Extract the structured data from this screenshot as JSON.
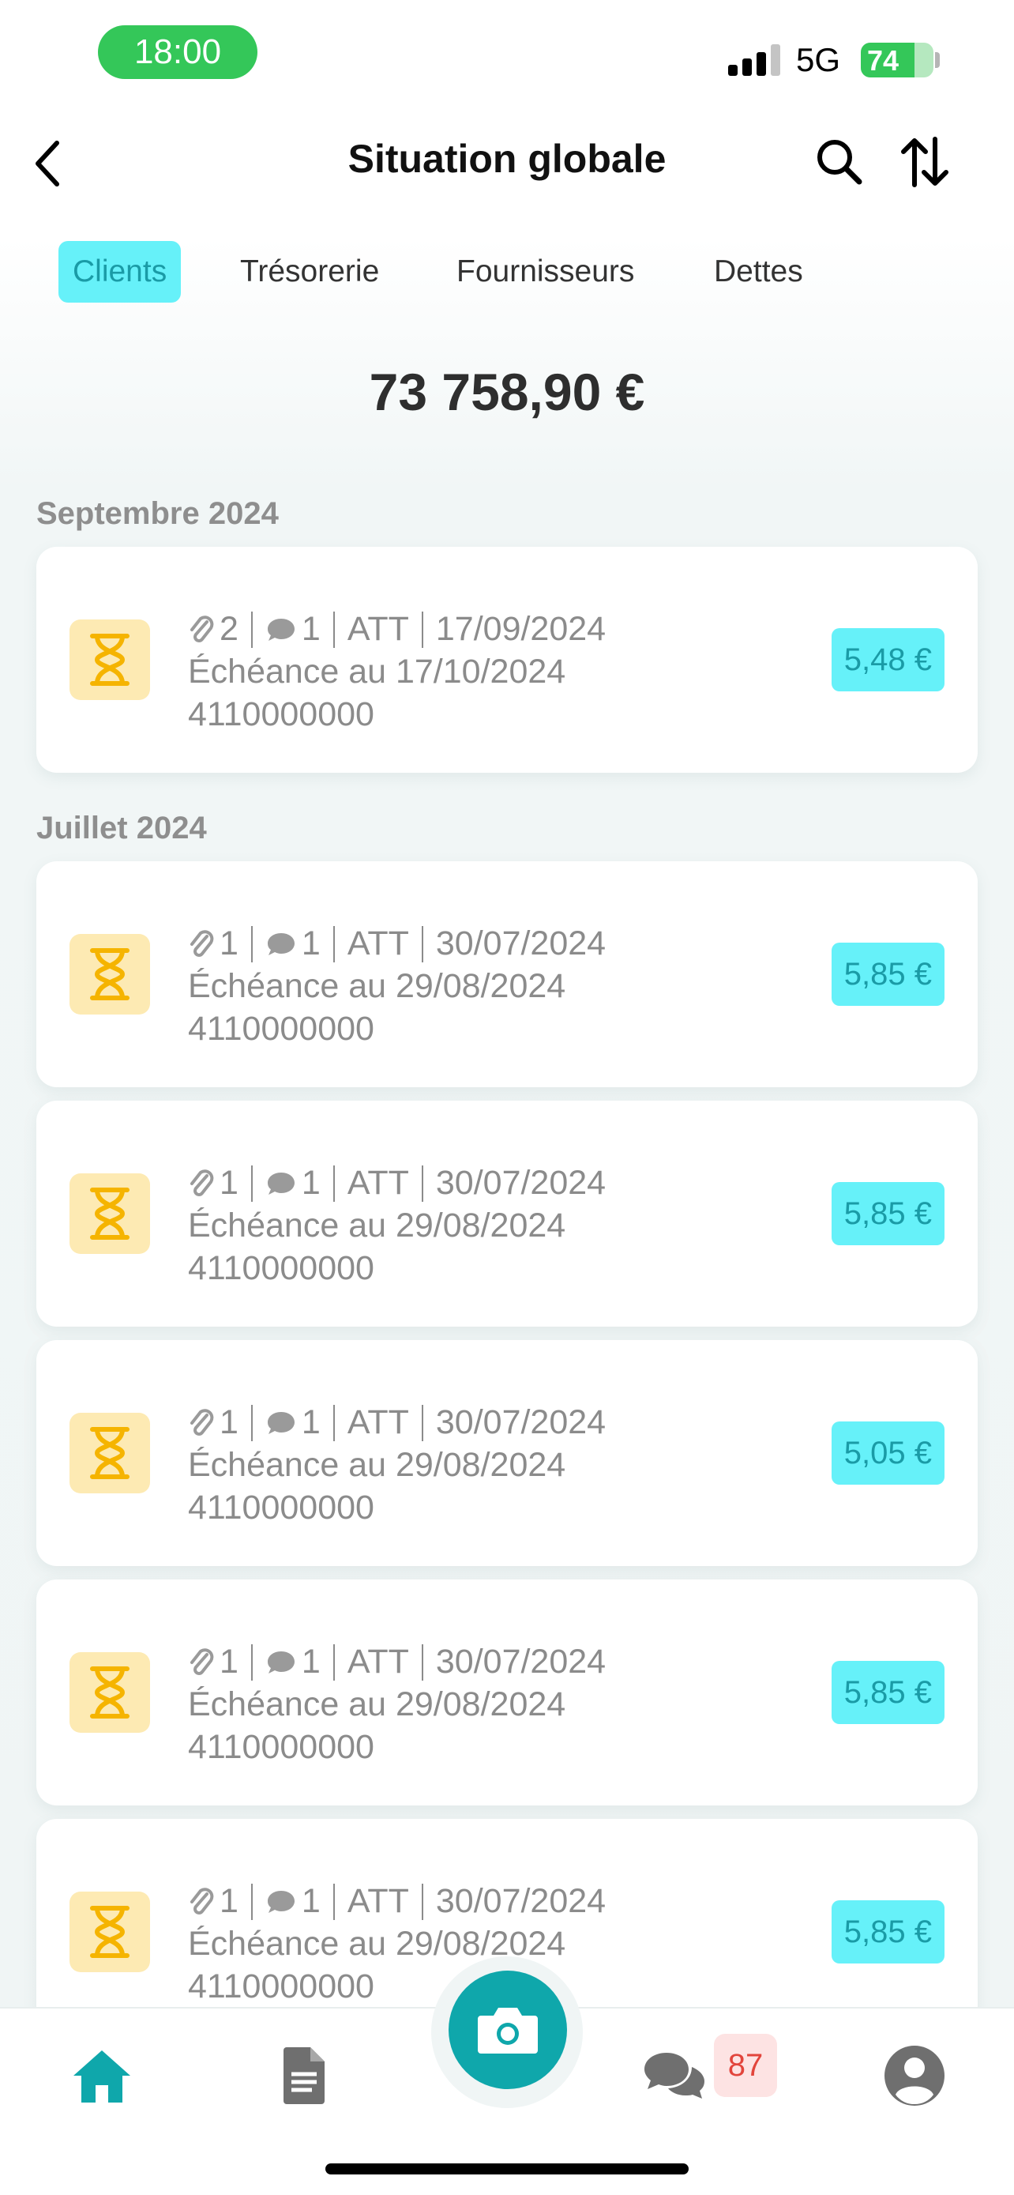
{
  "status_bar": {
    "time": "18:00",
    "network": "5G",
    "battery_level": "74",
    "battery_fraction": 0.74
  },
  "header": {
    "title": "Situation globale",
    "icons": {
      "back": "chevron-left-icon",
      "search": "search-icon",
      "sort": "sort-icon"
    }
  },
  "tabs": [
    {
      "label": "Clients",
      "active": true
    },
    {
      "label": "Trésorerie",
      "active": false
    },
    {
      "label": "Fournisseurs",
      "active": false
    },
    {
      "label": "Dettes",
      "active": false
    }
  ],
  "total": "73 758,90 €",
  "sections": [
    {
      "label": "Septembre 2024",
      "items": [
        {
          "attachments": "2",
          "comments": "1",
          "status": "ATT",
          "date": "17/09/2024",
          "due": "Échéance au 17/10/2024",
          "account": "4110000000",
          "amount": "5,48 €"
        }
      ]
    },
    {
      "label": "Juillet 2024",
      "items": [
        {
          "attachments": "1",
          "comments": "1",
          "status": "ATT",
          "date": "30/07/2024",
          "due": "Échéance au 29/08/2024",
          "account": "4110000000",
          "amount": "5,85 €"
        },
        {
          "attachments": "1",
          "comments": "1",
          "status": "ATT",
          "date": "30/07/2024",
          "due": "Échéance au 29/08/2024",
          "account": "4110000000",
          "amount": "5,85 €"
        },
        {
          "attachments": "1",
          "comments": "1",
          "status": "ATT",
          "date": "30/07/2024",
          "due": "Échéance au 29/08/2024",
          "account": "4110000000",
          "amount": "5,05 €"
        },
        {
          "attachments": "1",
          "comments": "1",
          "status": "ATT",
          "date": "30/07/2024",
          "due": "Échéance au 29/08/2024",
          "account": "4110000000",
          "amount": "5,85 €"
        },
        {
          "attachments": "1",
          "comments": "1",
          "status": "ATT",
          "date": "30/07/2024",
          "due": "Échéance au 29/08/2024",
          "account": "4110000000",
          "amount": "5,85 €"
        }
      ]
    }
  ],
  "bottom_nav": {
    "messages_badge": "87",
    "icons": [
      "home-icon",
      "document-icon",
      "camera-icon",
      "chat-icon",
      "profile-icon"
    ]
  },
  "colors": {
    "accent": "#66f1f9",
    "accent_text": "#1a9ba6",
    "pending": "#fdeab3",
    "pending_icon": "#f5b400",
    "camera": "#0fa7ab",
    "status_green": "#34c759"
  }
}
